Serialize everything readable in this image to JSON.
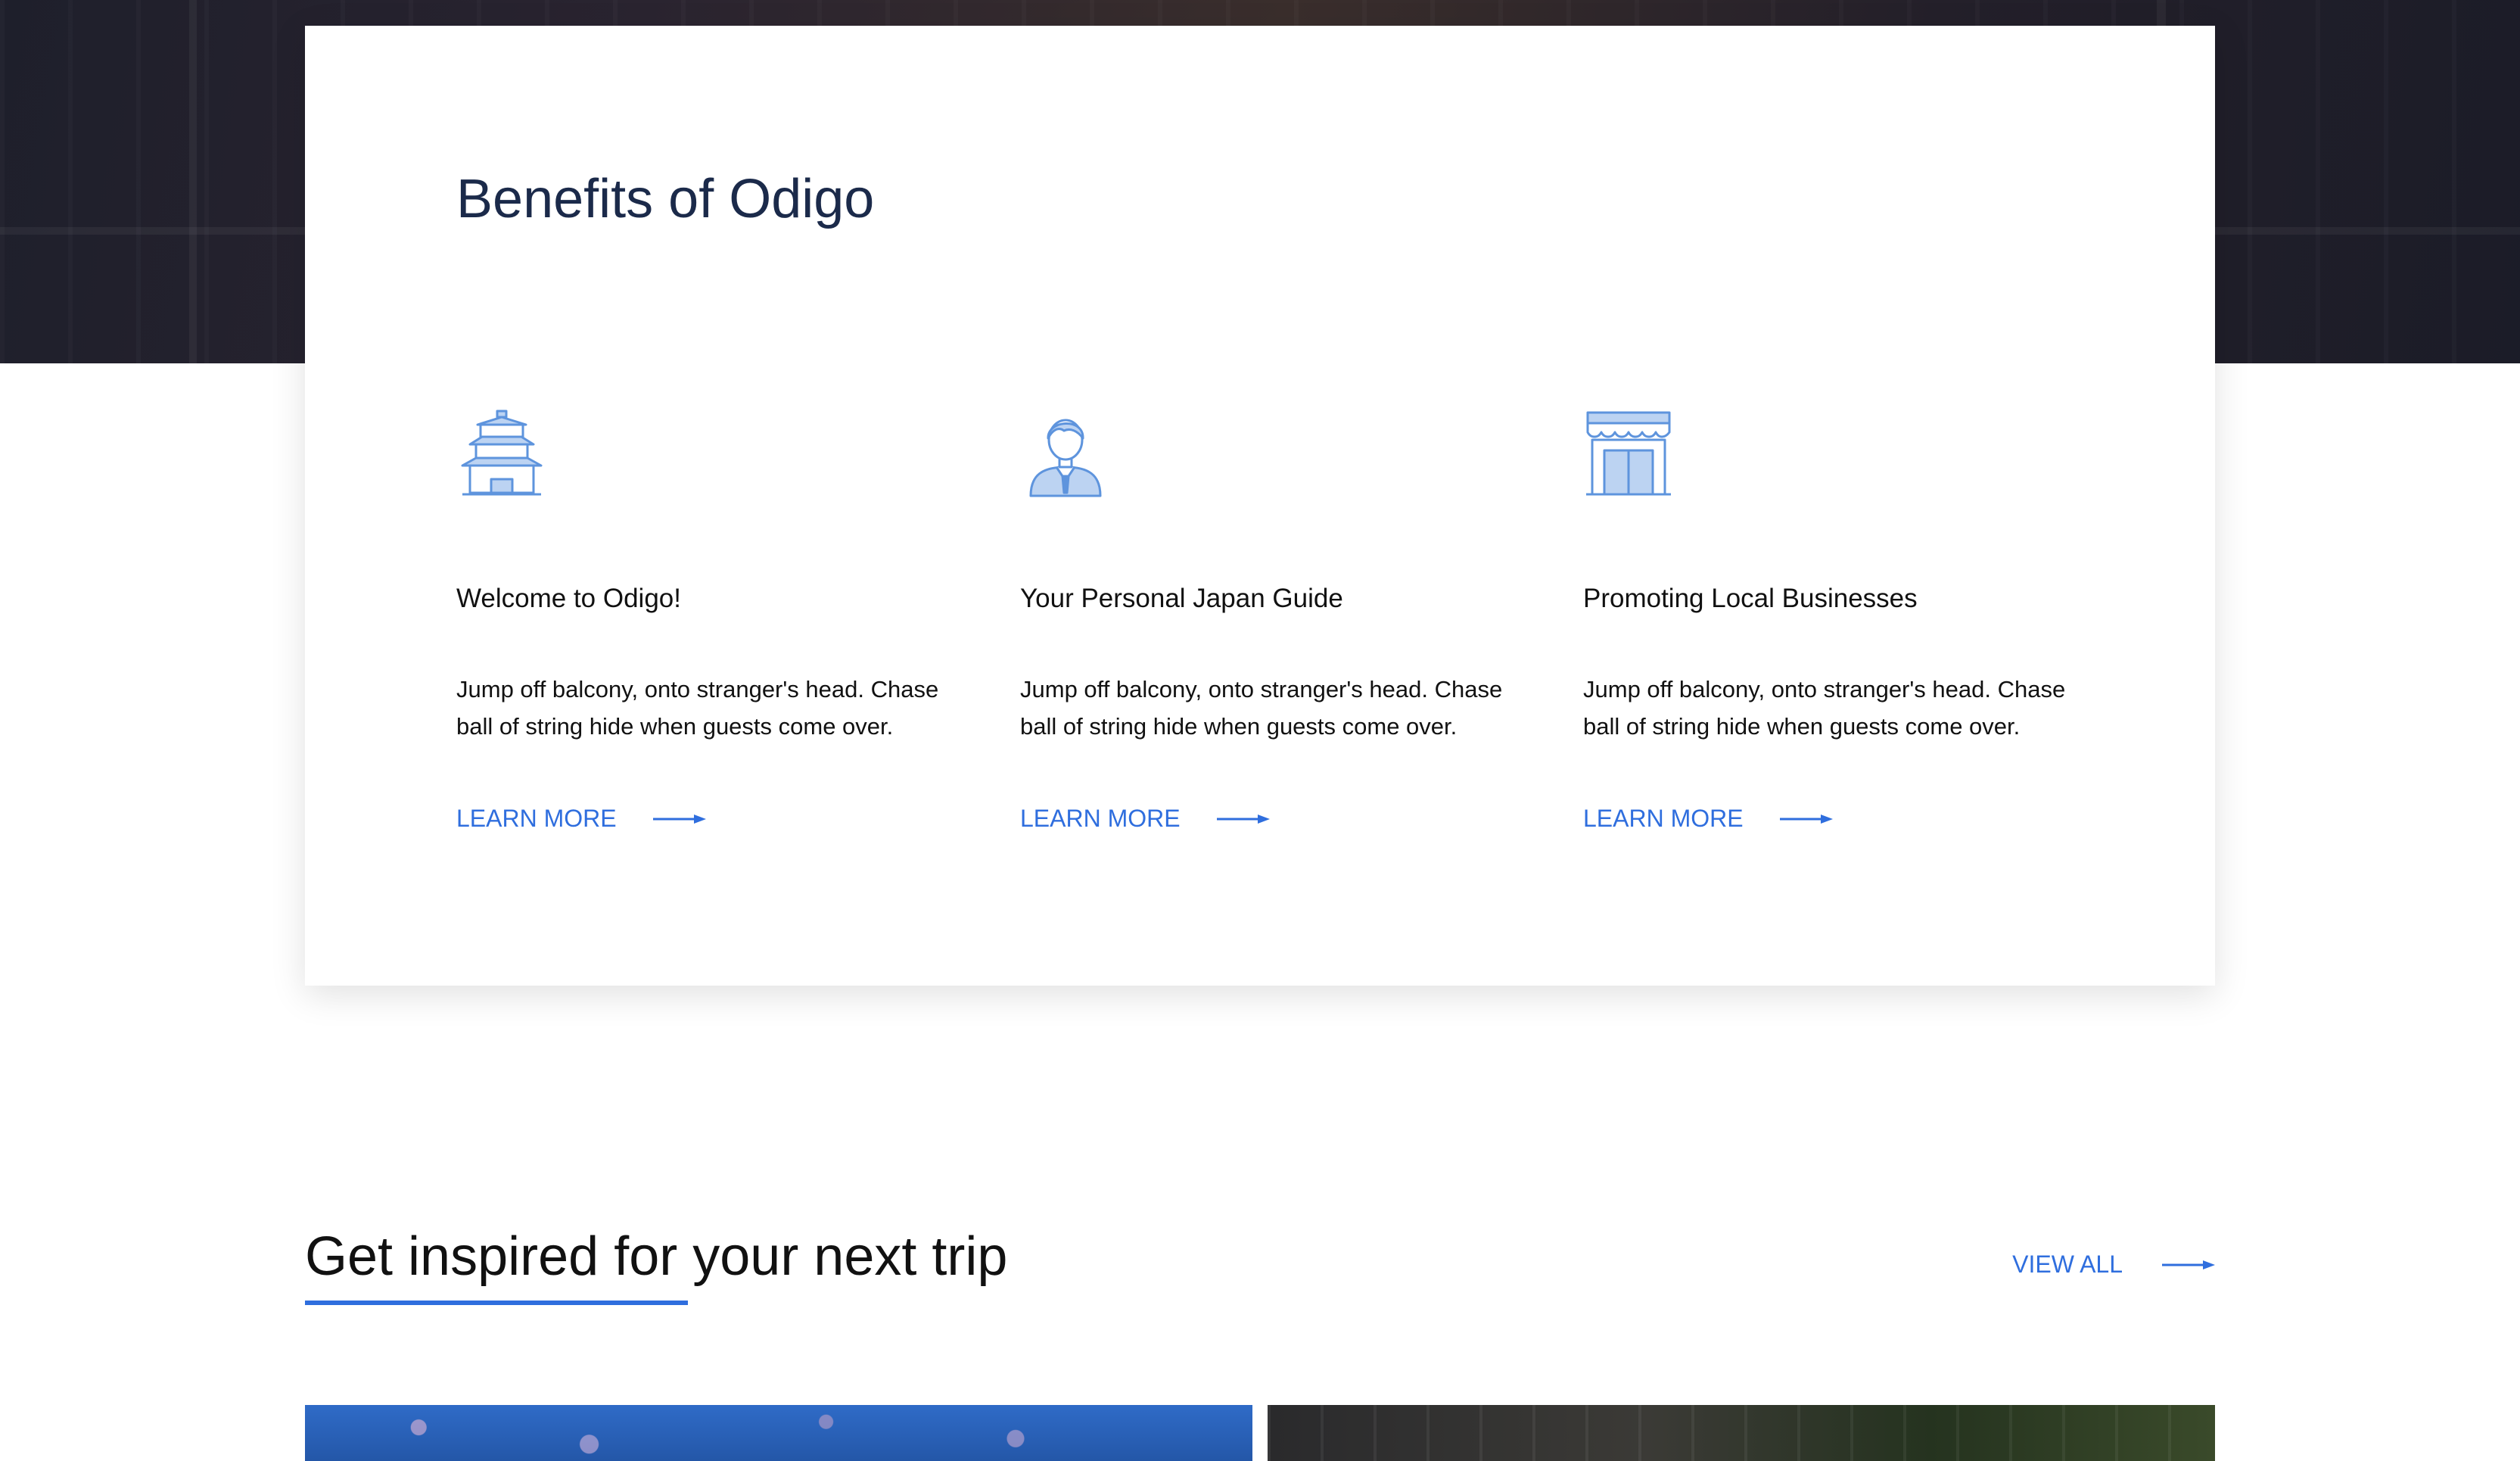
{
  "benefits": {
    "title": "Benefits of Odigo",
    "items": [
      {
        "icon": "pagoda-icon",
        "title": "Welcome to Odigo!",
        "text": "Jump off balcony, onto stranger's head. Chase ball of string hide when guests come over.",
        "link_label": "LEARN MORE"
      },
      {
        "icon": "guide-person-icon",
        "title": "Your Personal Japan Guide",
        "text": "Jump off balcony, onto stranger's head. Chase ball of string hide when guests come over.",
        "link_label": "LEARN MORE"
      },
      {
        "icon": "storefront-icon",
        "title": "Promoting Local Businesses",
        "text": "Jump off balcony, onto stranger's head. Chase ball of string hide when guests come over.",
        "link_label": "LEARN MORE"
      }
    ]
  },
  "inspired": {
    "title": "Get inspired for your next trip",
    "view_all_label": "VIEW ALL"
  },
  "colors": {
    "accent": "#2f6ede",
    "icon_fill": "#bcd3f2",
    "icon_stroke": "#5e94dd",
    "title_navy": "#1b2a4a"
  }
}
